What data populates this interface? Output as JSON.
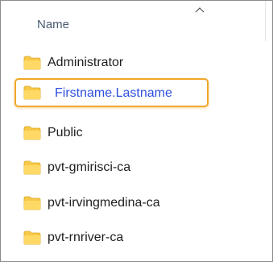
{
  "header": {
    "column_name": "Name",
    "sort_icon": "chevron-up-icon"
  },
  "folders": [
    {
      "name": "Administrator",
      "icon": "folder-icon"
    },
    {
      "name": "Firstname.Lastname",
      "icon": "folder-icon",
      "selected": true
    },
    {
      "name": "Public",
      "icon": "folder-icon"
    },
    {
      "name": "pvt-gmirisci-ca",
      "icon": "folder-icon"
    },
    {
      "name": "pvt-irvingmedina-ca",
      "icon": "folder-icon"
    },
    {
      "name": "pvt-rnriver-ca",
      "icon": "folder-icon"
    }
  ],
  "colors": {
    "highlight_border": "#f0a72a",
    "selected_text": "#2f4fe0",
    "folder_fill": "#f7c948"
  }
}
